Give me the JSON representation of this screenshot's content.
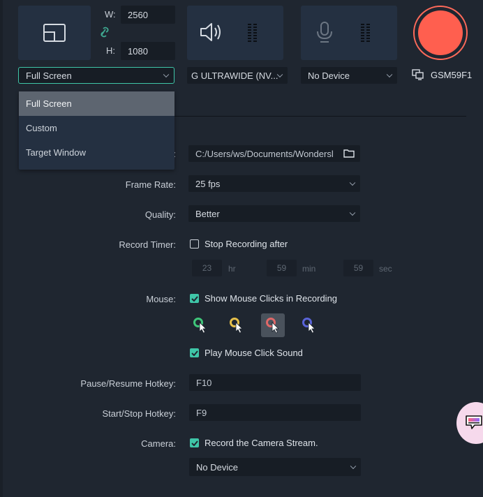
{
  "screen_area": {
    "icon": "screen-region-icon",
    "width_label": "W:",
    "width_value": "2560",
    "height_label": "H:",
    "height_value": "1080",
    "link_icon": "link-icon",
    "mode_select": "Full Screen",
    "mode_options": [
      "Full Screen",
      "Custom",
      "Target Window"
    ],
    "mode_options_highlighted": "Full Screen"
  },
  "audio": {
    "speaker_icon": "speaker-icon",
    "speaker_device": "G ULTRAWIDE (NV...",
    "mic_icon": "microphone-icon",
    "mic_device": "No Device"
  },
  "record": {
    "record_button_color": "#ff5f4f",
    "monitor_icon": "monitor-icon",
    "monitor_name": "GSM59F1"
  },
  "settings": {
    "save_to_path": "C:/Users/ws/Documents/Wondersl",
    "frame_rate_label": "Frame Rate:",
    "frame_rate_value": "25 fps",
    "quality_label": "Quality:",
    "quality_value": "Better",
    "record_timer_label": "Record Timer:",
    "stop_recording_label": "Stop Recording after",
    "stop_recording_checked": false,
    "timer_hours": "23",
    "timer_hours_unit": "hr",
    "timer_minutes": "59",
    "timer_minutes_unit": "min",
    "timer_seconds": "59",
    "timer_seconds_unit": "sec",
    "mouse_label": "Mouse:",
    "show_mouse_clicks_label": "Show Mouse Clicks in Recording",
    "show_mouse_clicks_checked": true,
    "cursor_colors": [
      "#3fc67a",
      "#e6c04a",
      "#e06868",
      "#5a64d8"
    ],
    "cursor_selected_index": 2,
    "play_click_sound_label": "Play Mouse Click Sound",
    "play_click_sound_checked": true,
    "pause_hotkey_label": "Pause/Resume Hotkey:",
    "pause_hotkey_value": "F10",
    "start_hotkey_label": "Start/Stop Hotkey:",
    "start_hotkey_value": "F9",
    "camera_label": "Camera:",
    "record_camera_label": "Record the Camera Stream.",
    "record_camera_checked": true,
    "camera_device": "No Device"
  },
  "colors": {
    "accent": "#3fc6a8",
    "background": "#1f2630",
    "tile": "#243041"
  }
}
